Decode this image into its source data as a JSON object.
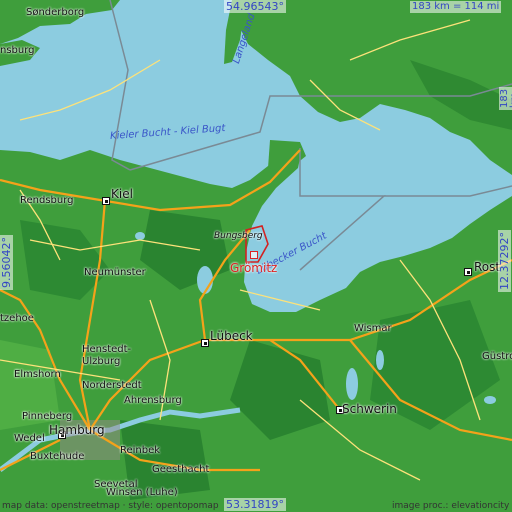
{
  "place": "Grömitz",
  "colors": {
    "water": "#8ccce0",
    "land_low": "#3f9e3c",
    "land_high": "#1f7a2a",
    "road_major": "#f4a21a",
    "road_minor": "#fde27a",
    "highlight": "#d22222",
    "label_blue": "#3346c4"
  },
  "coords": {
    "top": "54.96543°",
    "bottom": "53.31819°",
    "left": "9.56042°",
    "right": "12.37292°"
  },
  "scale": {
    "horizontal": "183 km = 114 mi",
    "vertical": "183 km = 114 mi"
  },
  "credits": {
    "left": "map data: openstreetmap · style: opentopomap",
    "right": "image proc.: elevationcity"
  },
  "water_labels": {
    "kiel_bay": "Kieler Bucht - Kiel Bugt",
    "lubeck_bay": "Lübecker Bucht",
    "langeland": "Langeland"
  },
  "places": {
    "sonderborg": "Sønderborg",
    "flensburg": "nsburg",
    "kiel": "Kiel",
    "rendsburg": "Rendsburg",
    "bungsberg": "Bungsberg",
    "neumunster": "Neumünster",
    "itzehoe": "tzehoe",
    "lubeck": "Lübeck",
    "henstedt": "Henstedt-\nUlzburg",
    "elmshorn": "Elmshorn",
    "norderstedt": "Norderstedt",
    "ahrensburg": "Ahrensburg",
    "pinneberg": "Pinneberg",
    "hamburg": "Hamburg",
    "wedel": "Wedel",
    "buxtehude": "Buxtehude",
    "reinbek": "Reinbek",
    "geesthacht": "Geesthacht",
    "seevetal": "Seevetal",
    "winsen": "Winsen (Luhe)",
    "wismar": "Wismar",
    "schwerin": "Schwerin",
    "rostock": "Rost",
    "gustrow": "Güstro"
  }
}
